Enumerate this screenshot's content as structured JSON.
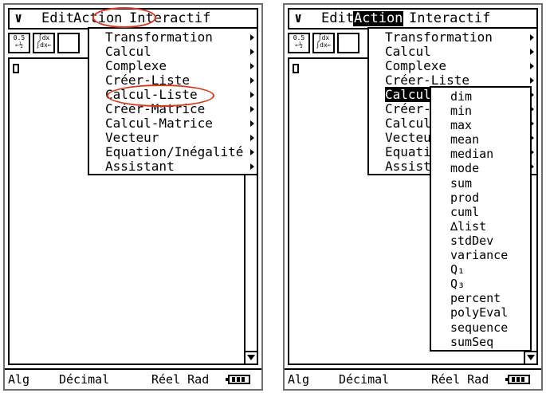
{
  "menubar": {
    "menu_arrow": "∨",
    "edit": "Edit",
    "action": "Action",
    "interactif": "Interactif"
  },
  "toolbar": {
    "btn1": "0.5 ←½",
    "btn2": "∫dx ∫dx←",
    "btn3": ""
  },
  "menu": {
    "items": [
      {
        "label": "Transformation"
      },
      {
        "label": "Calcul"
      },
      {
        "label": "Complexe"
      },
      {
        "label": "Créer-Liste"
      },
      {
        "label": "Calcul-Liste"
      },
      {
        "label": "Créer-Matrice"
      },
      {
        "label": "Calcul-Matrice"
      },
      {
        "label": "Vecteur"
      },
      {
        "label": "Equation/Inégalité"
      },
      {
        "label": "Assistant"
      }
    ]
  },
  "submenu": {
    "items": [
      "dim",
      "min",
      "max",
      "mean",
      "median",
      "mode",
      "sum",
      "prod",
      "cuml",
      "∆list",
      "stdDev",
      "variance",
      "Q₁",
      "Q₃",
      "percent",
      "polyEval",
      "sequence",
      "sumSeq"
    ]
  },
  "statusbar": {
    "mode": "Alg",
    "decimal": "Décimal",
    "real_rad": "Réel Rad"
  },
  "colors": {
    "annotation": "#d9381e",
    "frame": "#6e6e6e"
  }
}
